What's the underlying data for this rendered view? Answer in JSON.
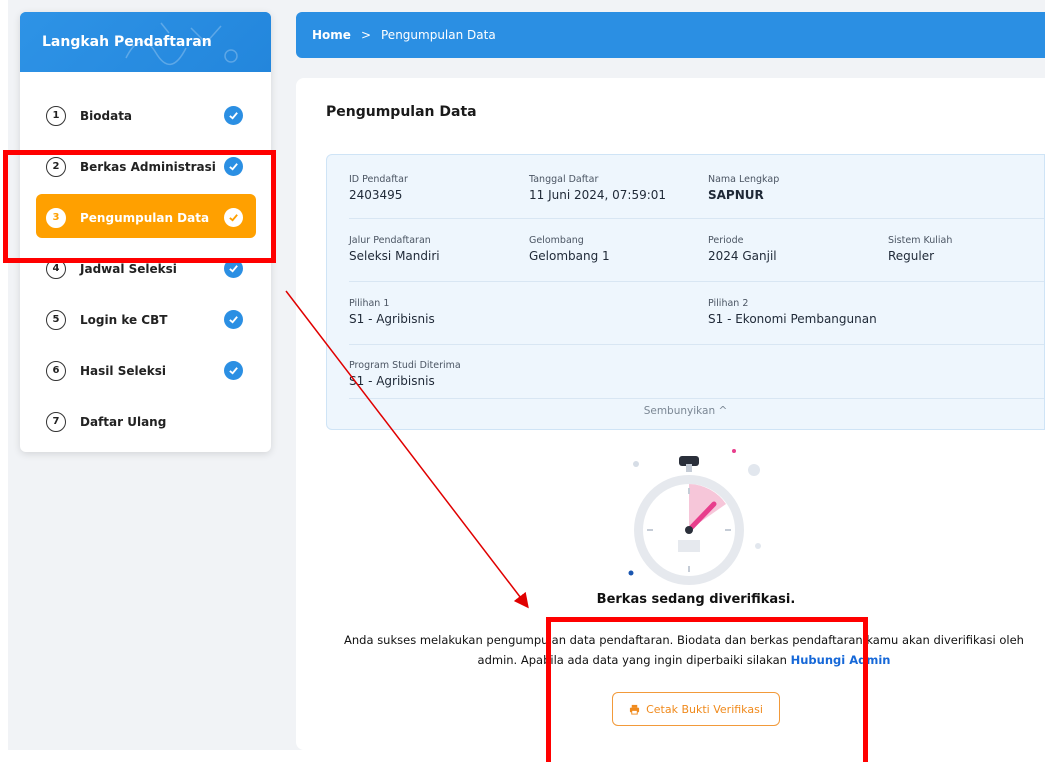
{
  "sidebar": {
    "title": "Langkah Pendaftaran",
    "steps": [
      {
        "num": "1",
        "label": "Biodata",
        "done": true
      },
      {
        "num": "2",
        "label": "Berkas Administrasi",
        "done": true
      },
      {
        "num": "3",
        "label": "Pengumpulan Data",
        "done": true,
        "active": true
      },
      {
        "num": "4",
        "label": "Jadwal Seleksi",
        "done": true
      },
      {
        "num": "5",
        "label": "Login ke CBT",
        "done": true
      },
      {
        "num": "6",
        "label": "Hasil Seleksi",
        "done": true
      },
      {
        "num": "7",
        "label": "Daftar Ulang",
        "done": false
      }
    ]
  },
  "breadcrumb": {
    "home": "Home",
    "separator": ">",
    "current": "Pengumpulan Data"
  },
  "main": {
    "title": "Pengumpulan Data",
    "info": {
      "id_label": "ID Pendaftar",
      "id_value": "2403495",
      "date_label": "Tanggal Daftar",
      "date_value": "11 Juni 2024, 07:59:01",
      "name_label": "Nama Lengkap",
      "name_value": "SAPNUR",
      "jalur_label": "Jalur Pendaftaran",
      "jalur_value": "Seleksi Mandiri",
      "gelombang_label": "Gelombang",
      "gelombang_value": "Gelombang 1",
      "periode_label": "Periode",
      "periode_value": "2024 Ganjil",
      "sistem_label": "Sistem Kuliah",
      "sistem_value": "Reguler",
      "pilihan1_label": "Pilihan 1",
      "pilihan1_value": "S1 - Agribisnis",
      "pilihan2_label": "Pilihan 2",
      "pilihan2_value": "S1 - Ekonomi Pembangunan",
      "prodi_label": "Program Studi Diterima",
      "prodi_value": "S1 - Agribisnis",
      "toggle": "Sembunyikan ^"
    },
    "status_title": "Berkas sedang diverifikasi.",
    "status_desc_1": "Anda sukses melakukan pengumpulan data pendaftaran. Biodata dan berkas pendaftaran kamu akan diverifikasi oleh",
    "status_desc_2": "admin. Apabila ada data yang ingin diperbaiki silakan",
    "contact_link": "Hubungi Admin",
    "print_button": "Cetak Bukti Verifikasi"
  },
  "colors": {
    "primary": "#2b8fe3",
    "active_step": "#ffa000",
    "button_orange": "#f08a1c",
    "annotation": "#ff0000"
  }
}
